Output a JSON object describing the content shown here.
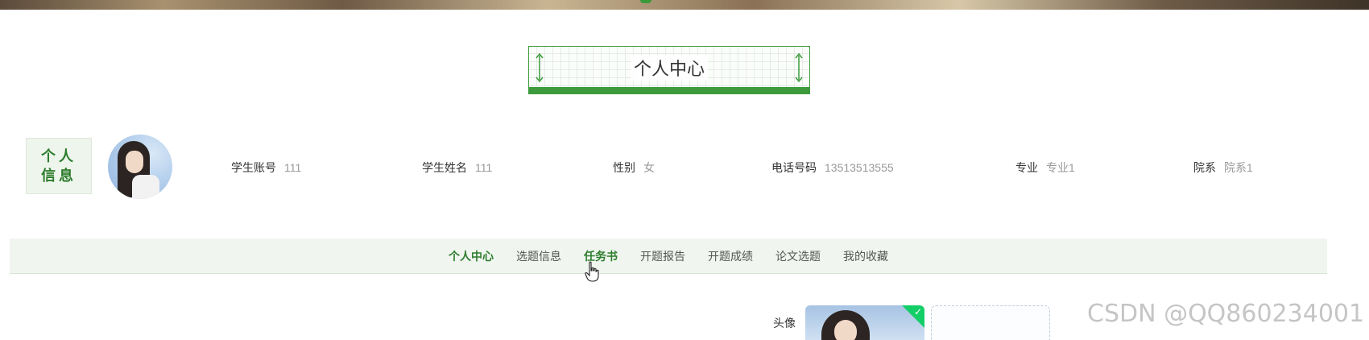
{
  "page_title": "个人中心",
  "profile": {
    "section_label": "个人信息",
    "fields": [
      {
        "key": "学生账号",
        "value": "111"
      },
      {
        "key": "学生姓名",
        "value": "111"
      },
      {
        "key": "性别",
        "value": "女"
      },
      {
        "key": "电话号码",
        "value": "13513513555"
      },
      {
        "key": "专业",
        "value": "专业1"
      },
      {
        "key": "院系",
        "value": "院系1"
      }
    ]
  },
  "nav": {
    "items": [
      {
        "label": "个人中心",
        "state": "active"
      },
      {
        "label": "选题信息",
        "state": ""
      },
      {
        "label": "任务书",
        "state": "hover"
      },
      {
        "label": "开题报告",
        "state": ""
      },
      {
        "label": "开题成绩",
        "state": ""
      },
      {
        "label": "论文选题",
        "state": ""
      },
      {
        "label": "我的收藏",
        "state": ""
      }
    ]
  },
  "form": {
    "avatar_label": "头像"
  },
  "watermark": "CSDN @QQ860234001",
  "colors": {
    "accent": "#3d9b3d",
    "active_text": "#2e7d2e",
    "nav_bg": "#f0f6ef",
    "upload_success": "#13ce66"
  },
  "icons": {
    "upload_success": "check-icon",
    "cursor": "hand-pointer-icon"
  }
}
